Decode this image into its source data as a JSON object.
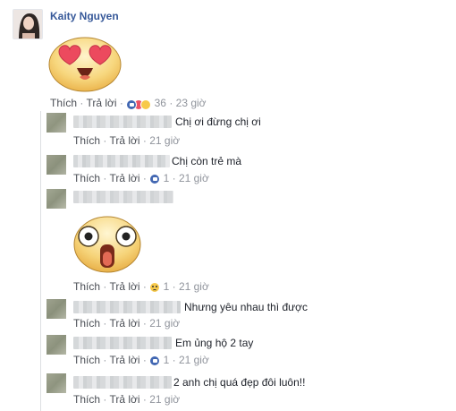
{
  "post": {
    "author": "Kaity Nguyen",
    "like": "Thích",
    "reply": "Trả lời",
    "reaction_count": "36",
    "time": "23 giờ"
  },
  "replies": [
    {
      "text": "Chị ơi đừng chị ơi",
      "like": "Thích",
      "reply": "Trả lời",
      "time": "21 giờ"
    },
    {
      "text": "Chị còn trẻ mà",
      "like": "Thích",
      "reply": "Trả lời",
      "reaction_count": "1",
      "time": "21 giờ"
    },
    {
      "text": "",
      "like": "Thích",
      "reply": "Trả lời",
      "reaction_count": "1",
      "time": "21 giờ"
    },
    {
      "text": "Nhưng yêu nhau thì được",
      "like": "Thích",
      "reply": "Trả lời",
      "time": "21 giờ"
    },
    {
      "text": "Em ủng hộ 2 tay",
      "like": "Thích",
      "reply": "Trả lời",
      "reaction_count": "1",
      "time": "21 giờ"
    },
    {
      "text": "2 anh chị quá đẹp đôi luôn!!",
      "like": "Thích",
      "reply": "Trả lời",
      "time": "21 giờ"
    }
  ],
  "colors": {
    "name_link": "#365899",
    "meta": "#90949c",
    "like_blue": "#4267b2"
  },
  "icons": [
    "heart-eyes-sticker",
    "shocked-face-sticker",
    "like-icon",
    "love-icon",
    "haha-icon",
    "sad-icon"
  ]
}
